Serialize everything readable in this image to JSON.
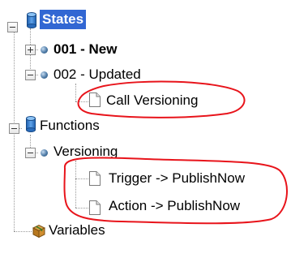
{
  "tree": {
    "states": {
      "label": "States",
      "children": [
        {
          "label": "001 - New"
        },
        {
          "label": "002 - Updated",
          "children": [
            {
              "label": "Call Versioning"
            }
          ]
        }
      ]
    },
    "functions": {
      "label": "Functions",
      "children": [
        {
          "label": "Versioning",
          "children": [
            {
              "label": "Trigger -> PublishNow"
            },
            {
              "label": "Action -> PublishNow"
            }
          ]
        }
      ]
    },
    "variables": {
      "label": "Variables"
    }
  },
  "colors": {
    "selection": "#3267d3",
    "annotation": "#e8141b",
    "tree_line": "#9a9a9a"
  },
  "icons": {
    "states": "database-icon",
    "functions": "database-icon",
    "state_item": "bullet-icon",
    "action_item": "document-icon",
    "variables": "box-icon"
  }
}
